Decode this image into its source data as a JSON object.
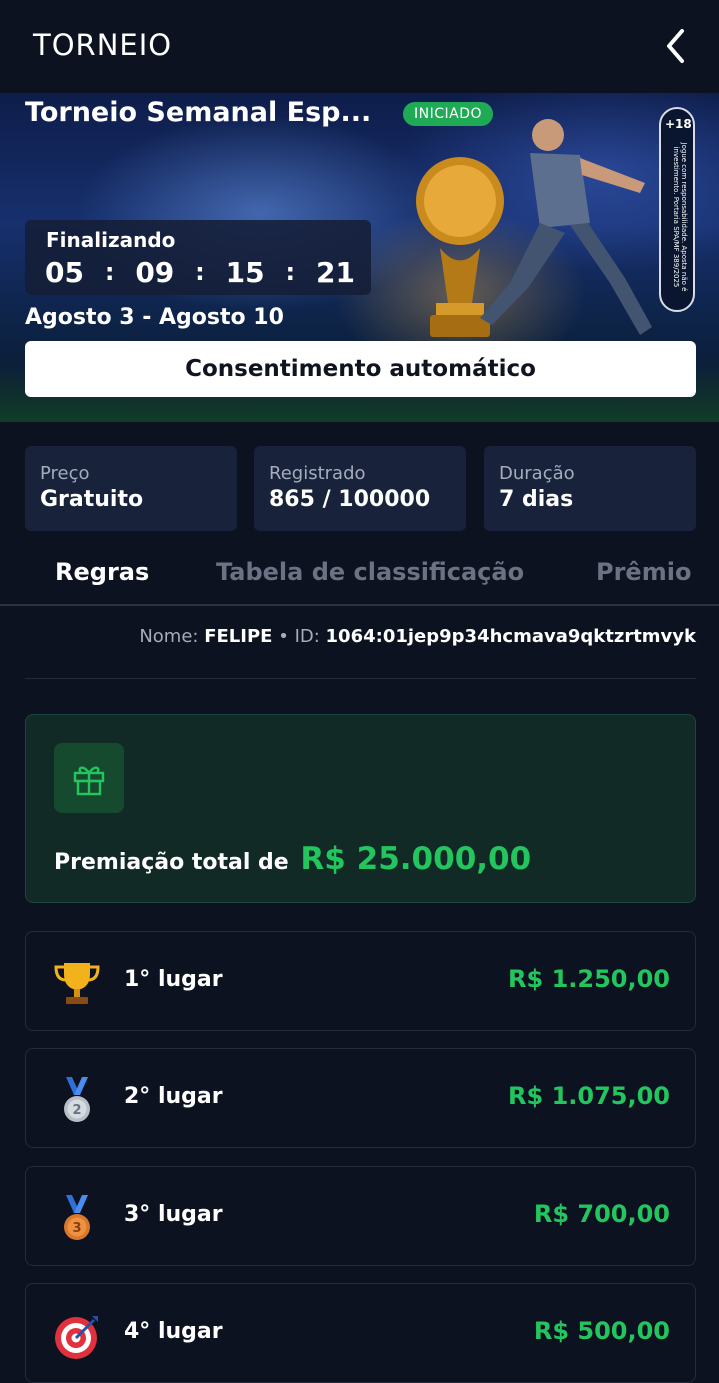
{
  "header": {
    "title": "TORNEIO"
  },
  "hero": {
    "title": "Torneio Semanal Esp...",
    "status_badge": "INICIADO",
    "age_label": "+18",
    "disclaimer": "Jogue com responsabilidade. Aposta não é investimento. Portaria SPA/MF 389/2025",
    "countdown": {
      "label": "Finalizando",
      "values": [
        "05",
        "09",
        "15",
        "21"
      ],
      "separator": ":"
    },
    "dates": "Agosto 3 - Agosto 10",
    "consent_button": "Consentimento automático"
  },
  "info": [
    {
      "key": "Preço",
      "value": "Gratuito"
    },
    {
      "key": "Registrado",
      "value": "865 / 100000"
    },
    {
      "key": "Duração",
      "value": "7 dias"
    }
  ],
  "tabs": [
    "Regras",
    "Tabela de classificação",
    "Prêmio"
  ],
  "user": {
    "name_label": "Nome:",
    "name": "FELIPE",
    "sep": "•",
    "id_label": "ID:",
    "id": "1064:01jep9p34hcmava9qktzrtmvyk"
  },
  "prize_total": {
    "label": "Premiação total de",
    "amount": "R$ 25.000,00",
    "accent_color": "#22c55e"
  },
  "places": [
    {
      "label": "1° lugar",
      "value": "R$ 1.250,00",
      "icon": "trophy-icon"
    },
    {
      "label": "2° lugar",
      "value": "R$ 1.075,00",
      "icon": "silver-medal-icon"
    },
    {
      "label": "3° lugar",
      "value": "R$ 700,00",
      "icon": "bronze-medal-icon"
    },
    {
      "label": "4° lugar",
      "value": "R$ 500,00",
      "icon": "target-icon"
    }
  ]
}
